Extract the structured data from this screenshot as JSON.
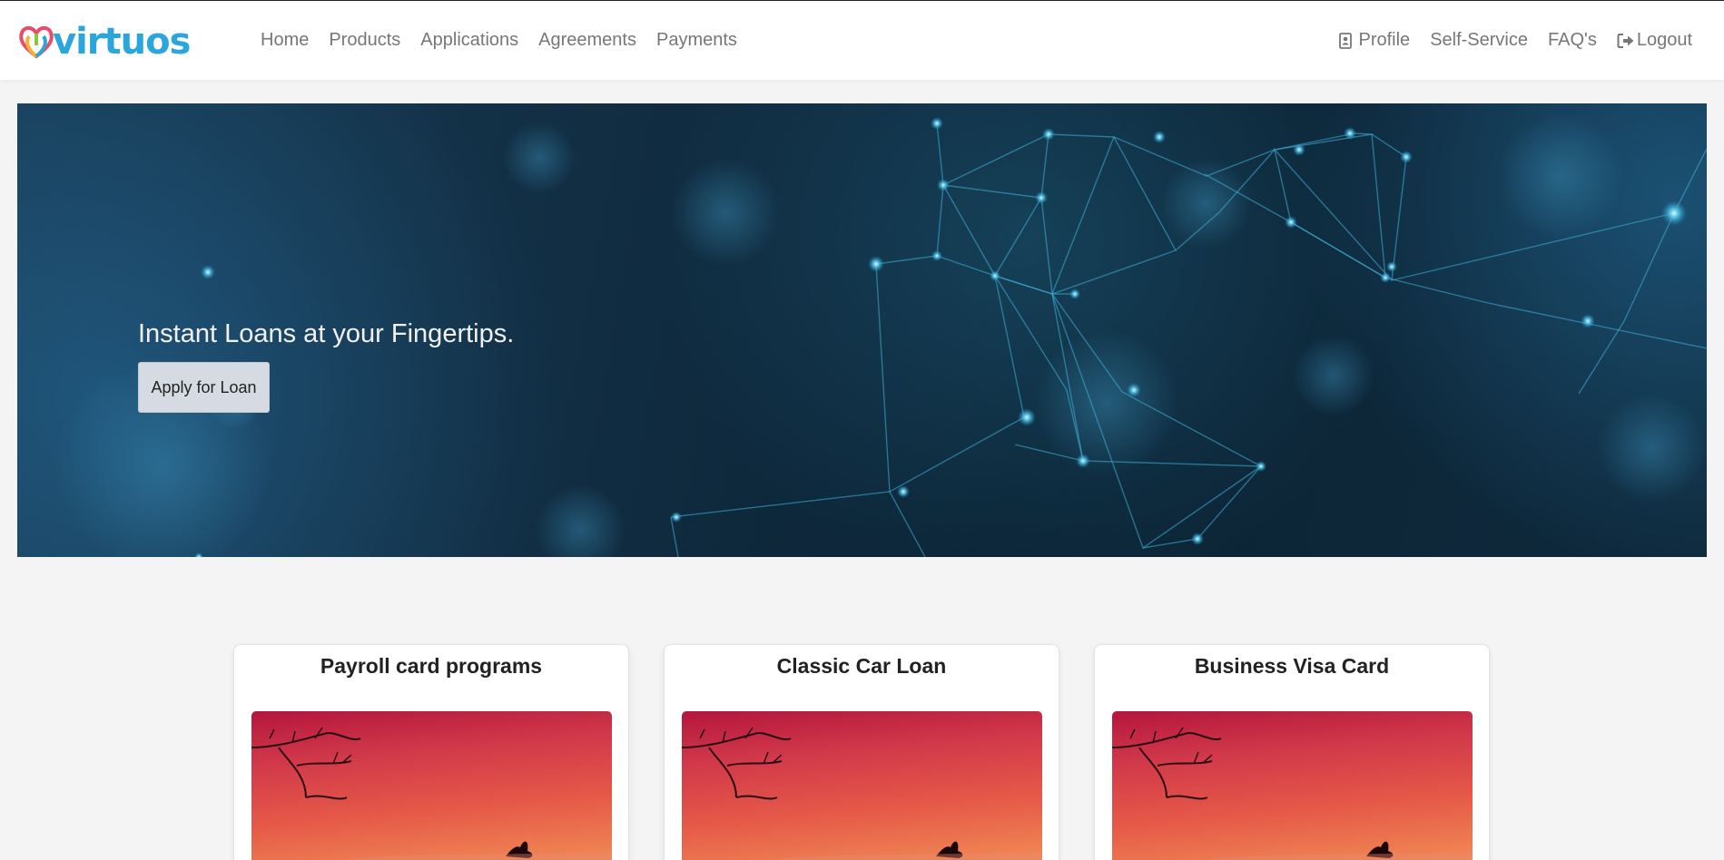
{
  "brand": {
    "logo_text": "virtuos"
  },
  "nav": {
    "left": [
      {
        "label": "Home"
      },
      {
        "label": "Products"
      },
      {
        "label": "Applications"
      },
      {
        "label": "Agreements"
      },
      {
        "label": "Payments"
      }
    ],
    "right": [
      {
        "label": "Profile",
        "icon": "profile-icon"
      },
      {
        "label": "Self-Service"
      },
      {
        "label": "FAQ's"
      },
      {
        "label": "Logout",
        "icon": "logout-icon"
      }
    ]
  },
  "hero": {
    "title": "Instant Loans at your Fingertips.",
    "button_label": "Apply for Loan"
  },
  "products": [
    {
      "title": "Payroll card programs"
    },
    {
      "title": "Classic Car Loan"
    },
    {
      "title": "Business Visa Card"
    }
  ],
  "colors": {
    "brand": "#2aa6dd",
    "hero_bg": "#112d42",
    "button_bg": "#d6dbe3",
    "card_image": "#d1384a"
  }
}
